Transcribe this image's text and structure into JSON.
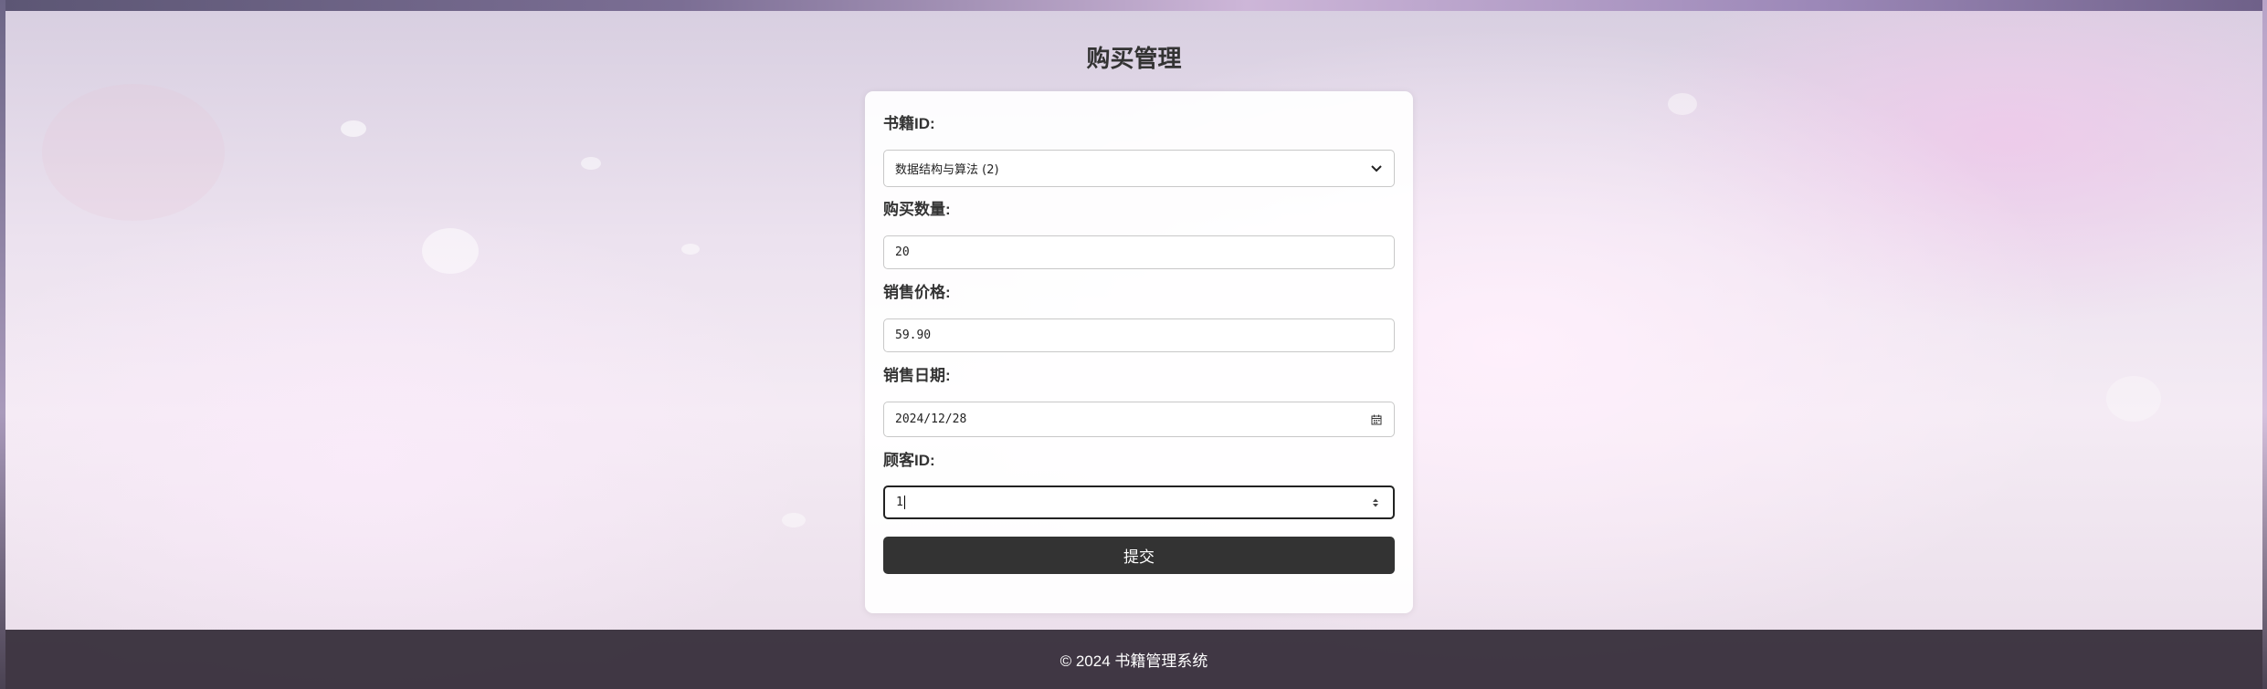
{
  "page": {
    "title": "购买管理"
  },
  "form": {
    "book_id": {
      "label": "书籍ID:",
      "value": "数据结构与算法 (2)"
    },
    "quantity": {
      "label": "购买数量:",
      "value": "20"
    },
    "price": {
      "label": "销售价格:",
      "value": "59.90"
    },
    "date": {
      "label": "销售日期:",
      "value": "2024/12/28"
    },
    "customer_id": {
      "label": "顾客ID:",
      "value": "1"
    },
    "submit_label": "提交"
  },
  "footer": {
    "text": "© 2024 书籍管理系统"
  },
  "colors": {
    "button": "#333333",
    "footer": "#28202c",
    "card": "#ffffff"
  }
}
